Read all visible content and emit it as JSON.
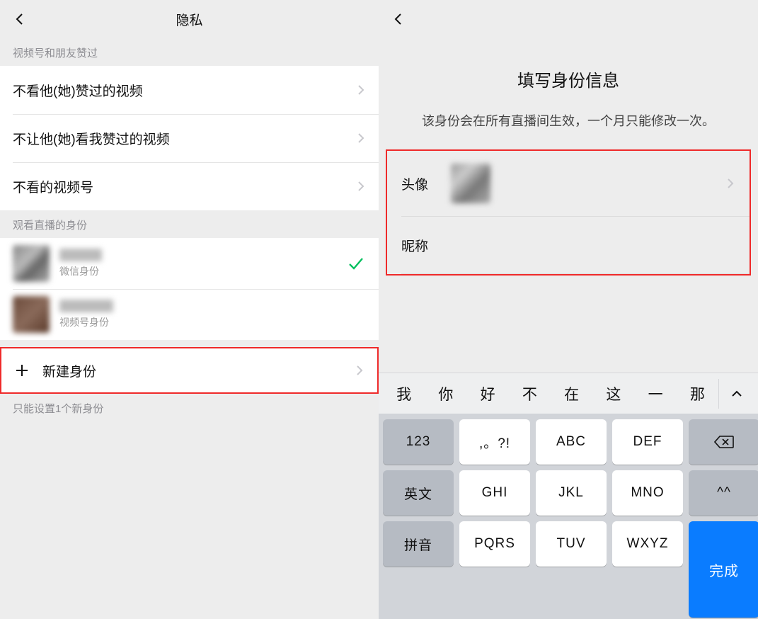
{
  "left": {
    "title": "隐私",
    "section1_title": "视频号和朋友赞过",
    "rows": [
      {
        "label": "不看他(她)赞过的视频"
      },
      {
        "label": "不让他(她)看我赞过的视频"
      },
      {
        "label": "不看的视频号"
      }
    ],
    "section2_title": "观看直播的身份",
    "identities": [
      {
        "sub": "微信身份",
        "checked": true
      },
      {
        "sub": "视频号身份",
        "checked": false
      }
    ],
    "add_label": "新建身份",
    "footnote": "只能设置1个新身份"
  },
  "right": {
    "form_title": "填写身份信息",
    "form_desc": "该身份会在所有直播间生效，一个月只能修改一次。",
    "avatar_label": "头像",
    "nickname_label": "昵称",
    "candidates": [
      "我",
      "你",
      "好",
      "不",
      "在",
      "这",
      "一",
      "那"
    ],
    "keys": {
      "k123": "123",
      "punct": ",。?!",
      "abc": "ABC",
      "def": "DEF",
      "eng": "英文",
      "ghi": "GHI",
      "jkl": "JKL",
      "mno": "MNO",
      "emoji": "^^",
      "pinyin": "拼音",
      "pqrs": "PQRS",
      "tuv": "TUV",
      "wxyz": "WXYZ",
      "done": "完成"
    }
  }
}
